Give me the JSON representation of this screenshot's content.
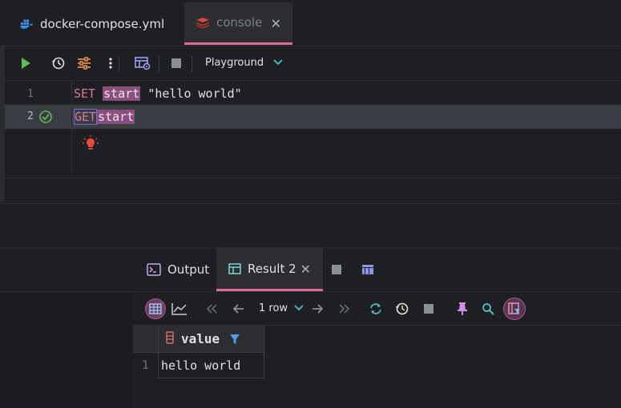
{
  "tabs": [
    {
      "label": "docker-compose.yml",
      "icon": "docker-icon",
      "active": false
    },
    {
      "label": "console",
      "icon": "redis-icon",
      "active": true
    }
  ],
  "toolbar": {
    "buttons": [
      "run-icon",
      "history-icon",
      "settings-sliders-icon",
      "more-vertical-icon",
      "table-view-icon",
      "stop-icon"
    ],
    "session": "Playground"
  },
  "editor": {
    "lines": [
      {
        "number": "1",
        "command": "SET",
        "key": "start",
        "value": "\"hello world\""
      },
      {
        "number": "2",
        "command": "GET",
        "key": "start",
        "value": ""
      }
    ]
  },
  "panel": {
    "tabs": [
      {
        "label": "Output",
        "icon": "output-console-icon"
      },
      {
        "label": "Result 2",
        "icon": "table-icon",
        "active": true
      }
    ],
    "rows_label": "1 row",
    "toolbar_icons": [
      "grid-view-icon",
      "chart-icon",
      "first-page-icon",
      "prev-page-icon",
      "rows-dropdown",
      "next-page-icon",
      "last-page-icon",
      "reload-icon",
      "history-icon",
      "stop-icon",
      "pin-icon",
      "search-icon",
      "column-filter-icon"
    ]
  },
  "grid": {
    "columns": [
      "value"
    ],
    "rows": [
      {
        "num": "1",
        "value": "hello world"
      }
    ]
  },
  "colors": {
    "accent_tab": "#e06c9f",
    "keyword": "#d57a8f",
    "highlight_arg": "#8a4f7d",
    "current_line": "#3a3c44",
    "run_green": "#5fb85a"
  }
}
